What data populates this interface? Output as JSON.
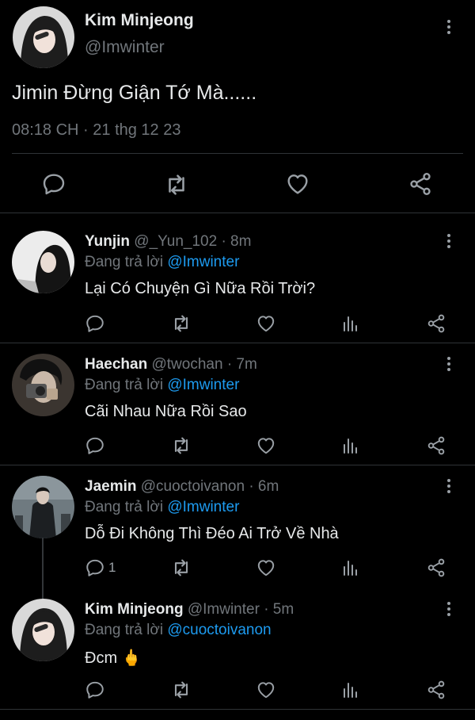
{
  "main_tweet": {
    "name": "Kim Minjeong",
    "handle": "@Imwinter",
    "text": "Jimin Đừng Giận Tớ Mà......",
    "timestamp": "08:18 CH · 21 thg 12 23"
  },
  "replies": [
    {
      "name": "Yunjin",
      "handle": "@_Yun_102",
      "time": "· 8m",
      "replying_prefix": "Đang trả lời",
      "replying_to": "@Imwinter",
      "text": "Lại Có Chuyện Gì Nữa Rồi Trời?",
      "reply_count": ""
    },
    {
      "name": "Haechan",
      "handle": "@twochan",
      "time": "· 7m",
      "replying_prefix": "Đang trả lời",
      "replying_to": "@Imwinter",
      "text": "Cãi Nhau Nữa Rồi Sao",
      "reply_count": ""
    },
    {
      "name": "Jaemin",
      "handle": "@cuoctoivanon",
      "time": "· 6m",
      "replying_prefix": "Đang trả lời",
      "replying_to": "@Imwinter",
      "text": "Dỗ Đi Không Thì Đéo Ai Trở Về Nhà",
      "reply_count": "1"
    },
    {
      "name": "Kim Minjeong",
      "handle": "@Imwinter",
      "time": "· 5m",
      "replying_prefix": "Đang trả lời",
      "replying_to": "@cuoctoivanon",
      "text": "Đcm 🖕",
      "reply_count": ""
    }
  ],
  "icons": {
    "reply": "reply-icon",
    "retweet": "retweet-icon",
    "like": "heart-icon",
    "views": "analytics-icon",
    "share": "share-icon",
    "more": "more-icon"
  },
  "colors": {
    "background": "#000000",
    "accent": "#1d9bf0",
    "muted": "#71767b",
    "divider": "#2f3336"
  }
}
